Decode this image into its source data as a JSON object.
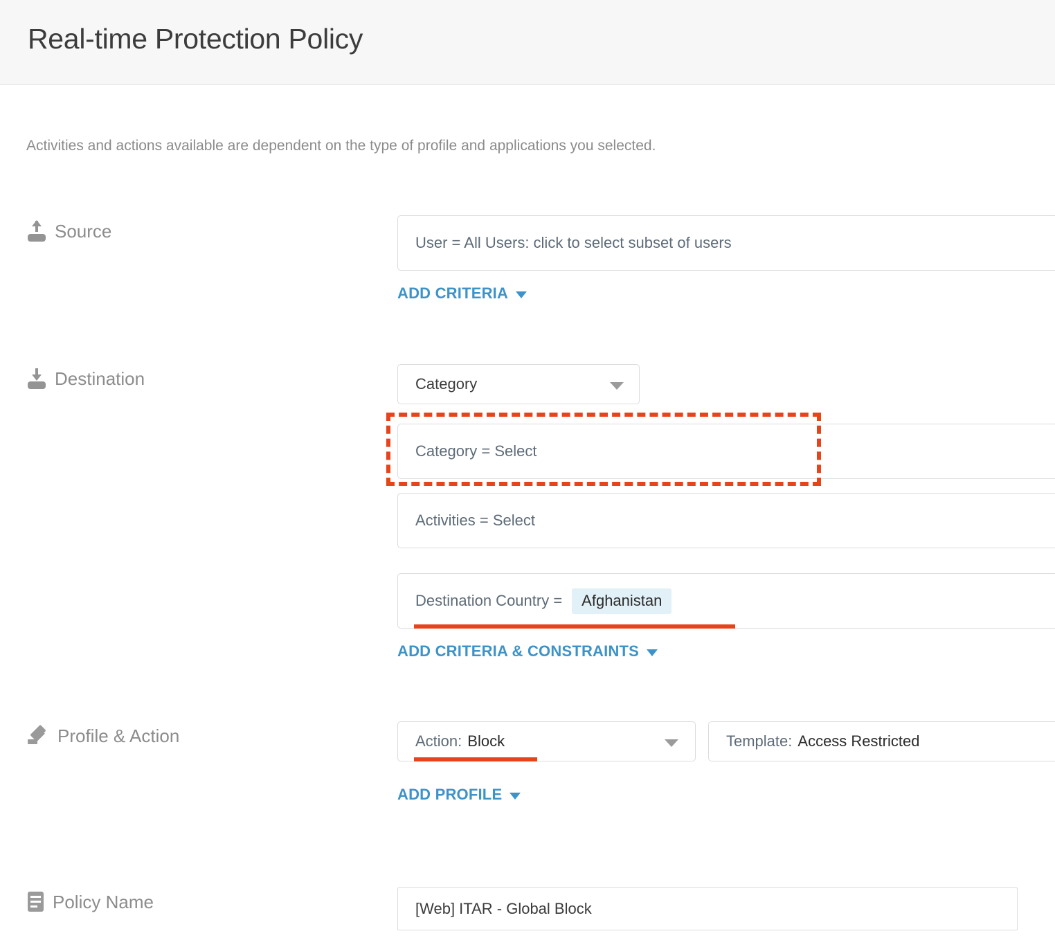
{
  "header": {
    "title": "Real-time Protection Policy"
  },
  "description": "Activities and actions available are dependent on the type of profile and applications you selected.",
  "sections": {
    "source": {
      "label": "Source",
      "icon": "upload-icon",
      "field_value": "User = All Users: click to select subset of users",
      "link_label": "ADD CRITERIA"
    },
    "destination": {
      "label": "Destination",
      "icon": "download-icon",
      "dropdown_value": "Category",
      "criteria": [
        {
          "text": "Category = Select"
        },
        {
          "text": "Activities = Select"
        }
      ],
      "country_label": "Destination Country =",
      "country_value": "Afghanistan",
      "link_label": "ADD CRITERIA & CONSTRAINTS"
    },
    "profile_action": {
      "label": "Profile & Action",
      "icon": "gavel-icon",
      "action_label": "Action:",
      "action_value": "Block",
      "template_label": "Template:",
      "template_value": "Access Restricted",
      "link_label": "ADD PROFILE"
    },
    "policy_name": {
      "label": "Policy Name",
      "icon": "document-icon",
      "value": "[Web] ITAR - Global Block"
    }
  },
  "annotations": {
    "highlight_color": "#e8441c",
    "link_color": "#3d93c8",
    "chip_color": "#e2f0f7"
  }
}
